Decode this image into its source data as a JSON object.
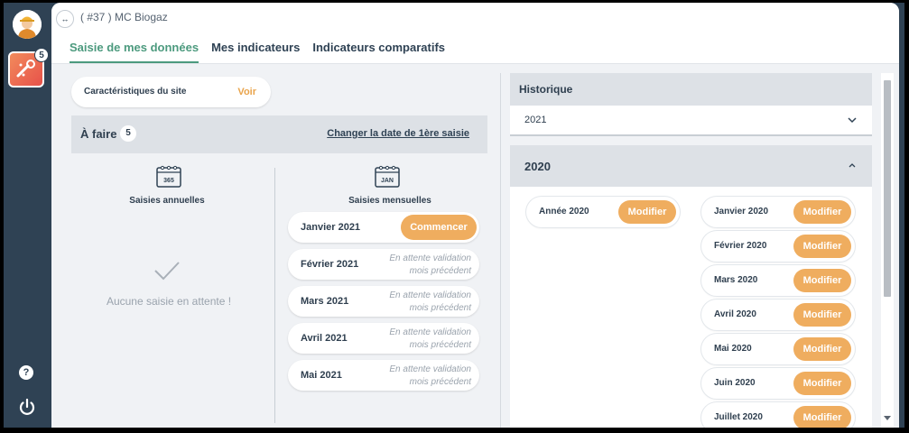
{
  "header": {
    "expand_symbol": "↔",
    "site_title": "( #37 ) MC Biogaz"
  },
  "sidebar": {
    "app_badge": "5",
    "help_symbol": "?"
  },
  "tabs": [
    {
      "label": "Saisie de mes données",
      "active": true
    },
    {
      "label": "Mes indicateurs",
      "active": false
    },
    {
      "label": "Indicateurs comparatifs",
      "active": false
    }
  ],
  "site_characteristics": {
    "label": "Caractéristiques du site",
    "action": "Voir"
  },
  "todo": {
    "title": "À faire",
    "count": "5",
    "change_date_link": "Changer la date de 1ère saisie"
  },
  "annual": {
    "icon_text": "365",
    "title": "Saisies annuelles",
    "empty_text": "Aucune saisie en attente !"
  },
  "monthly": {
    "icon_text": "JAN",
    "title": "Saisies mensuelles",
    "items": [
      {
        "month": "Janvier 2021",
        "button": "Commencer"
      },
      {
        "month": "Février 2021",
        "status_line1": "En attente validation",
        "status_line2": "mois précédent"
      },
      {
        "month": "Mars 2021",
        "status_line1": "En attente validation",
        "status_line2": "mois précédent"
      },
      {
        "month": "Avril 2021",
        "status_line1": "En attente validation",
        "status_line2": "mois précédent"
      },
      {
        "month": "Mai 2021",
        "status_line1": "En attente validation",
        "status_line2": "mois précédent"
      }
    ]
  },
  "history": {
    "title": "Historique",
    "selected_year": "2021",
    "expanded_year": "2020",
    "annual_entry": {
      "label": "Année 2020",
      "button": "Modifier"
    },
    "monthly_entries": [
      {
        "label": "Janvier 2020",
        "button": "Modifier"
      },
      {
        "label": "Février 2020",
        "button": "Modifier"
      },
      {
        "label": "Mars 2020",
        "button": "Modifier"
      },
      {
        "label": "Avril 2020",
        "button": "Modifier"
      },
      {
        "label": "Mai 2020",
        "button": "Modifier"
      },
      {
        "label": "Juin 2020",
        "button": "Modifier"
      },
      {
        "label": "Juillet 2020",
        "button": "Modifier"
      }
    ]
  },
  "colors": {
    "accent_green": "#4c9a7e",
    "action_orange": "#efad5f",
    "sidebar": "#2f4254"
  }
}
